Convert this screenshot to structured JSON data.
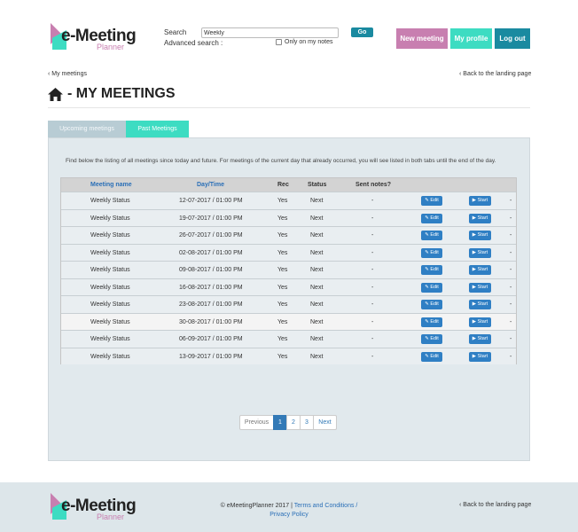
{
  "logo": {
    "main": "e-Meeting",
    "sub": "Planner"
  },
  "search": {
    "label": "Search",
    "value": "Weekly",
    "advanced_label": "Advanced search :",
    "only_notes_label": "Only on my notes",
    "go_label": "Go"
  },
  "header_buttons": {
    "new_meeting": "New meeting",
    "my_profile": "My profile",
    "log_out": "Log out"
  },
  "breadcrumb": {
    "back_left": "My meetings",
    "back_right": "Back to the landing page"
  },
  "page": {
    "title": "- MY MEETINGS"
  },
  "tabs": [
    {
      "label": "Upcoming meetings"
    },
    {
      "label": "Past Meetings"
    }
  ],
  "intro": "Find below the listing of all meetings since today and future. For meetings of the current day that already occurred, you will see listed in both tabs until the end of the day.",
  "table": {
    "headers": {
      "name": "Meeting name",
      "datetime": "Day/Time",
      "rec": "Rec",
      "status": "Status",
      "sent": "Sent notes?"
    },
    "edit_label": "Edit",
    "start_label": "Start",
    "rows": [
      {
        "name": "Weekly Status",
        "datetime": "12-07-2017 / 01:00 PM",
        "rec": "Yes",
        "status": "Next",
        "sent": "-",
        "last": "-"
      },
      {
        "name": "Weekly Status",
        "datetime": "19-07-2017 / 01:00 PM",
        "rec": "Yes",
        "status": "Next",
        "sent": "-",
        "last": "-"
      },
      {
        "name": "Weekly Status",
        "datetime": "26-07-2017 / 01:00 PM",
        "rec": "Yes",
        "status": "Next",
        "sent": "-",
        "last": "-"
      },
      {
        "name": "Weekly Status",
        "datetime": "02-08-2017 / 01:00 PM",
        "rec": "Yes",
        "status": "Next",
        "sent": "-",
        "last": "-"
      },
      {
        "name": "Weekly Status",
        "datetime": "09-08-2017 / 01:00 PM",
        "rec": "Yes",
        "status": "Next",
        "sent": "-",
        "last": "-"
      },
      {
        "name": "Weekly Status",
        "datetime": "16-08-2017 / 01:00 PM",
        "rec": "Yes",
        "status": "Next",
        "sent": "-",
        "last": "-"
      },
      {
        "name": "Weekly Status",
        "datetime": "23-08-2017 / 01:00 PM",
        "rec": "Yes",
        "status": "Next",
        "sent": "-",
        "last": "-"
      },
      {
        "name": "Weekly Status",
        "datetime": "30-08-2017 / 01:00 PM",
        "rec": "Yes",
        "status": "Next",
        "sent": "-",
        "last": "-"
      },
      {
        "name": "Weekly Status",
        "datetime": "06-09-2017 / 01:00 PM",
        "rec": "Yes",
        "status": "Next",
        "sent": "-",
        "last": "-"
      },
      {
        "name": "Weekly Status",
        "datetime": "13-09-2017 / 01:00 PM",
        "rec": "Yes",
        "status": "Next",
        "sent": "-",
        "last": "-"
      }
    ]
  },
  "pagination": {
    "prev": "Previous",
    "pages": [
      "1",
      "2",
      "3"
    ],
    "active": "1",
    "next": "Next"
  },
  "footer": {
    "copyright": "© eMeetingPlanner 2017 |",
    "terms": "Terms and Conditions /",
    "privacy": "Privacy Policy",
    "back": "Back to the landing page"
  },
  "colors": {
    "pink": "#c87fb0",
    "teal": "#3ddcc2",
    "dark_teal": "#1a8aa0",
    "blue": "#2f7fc4"
  }
}
